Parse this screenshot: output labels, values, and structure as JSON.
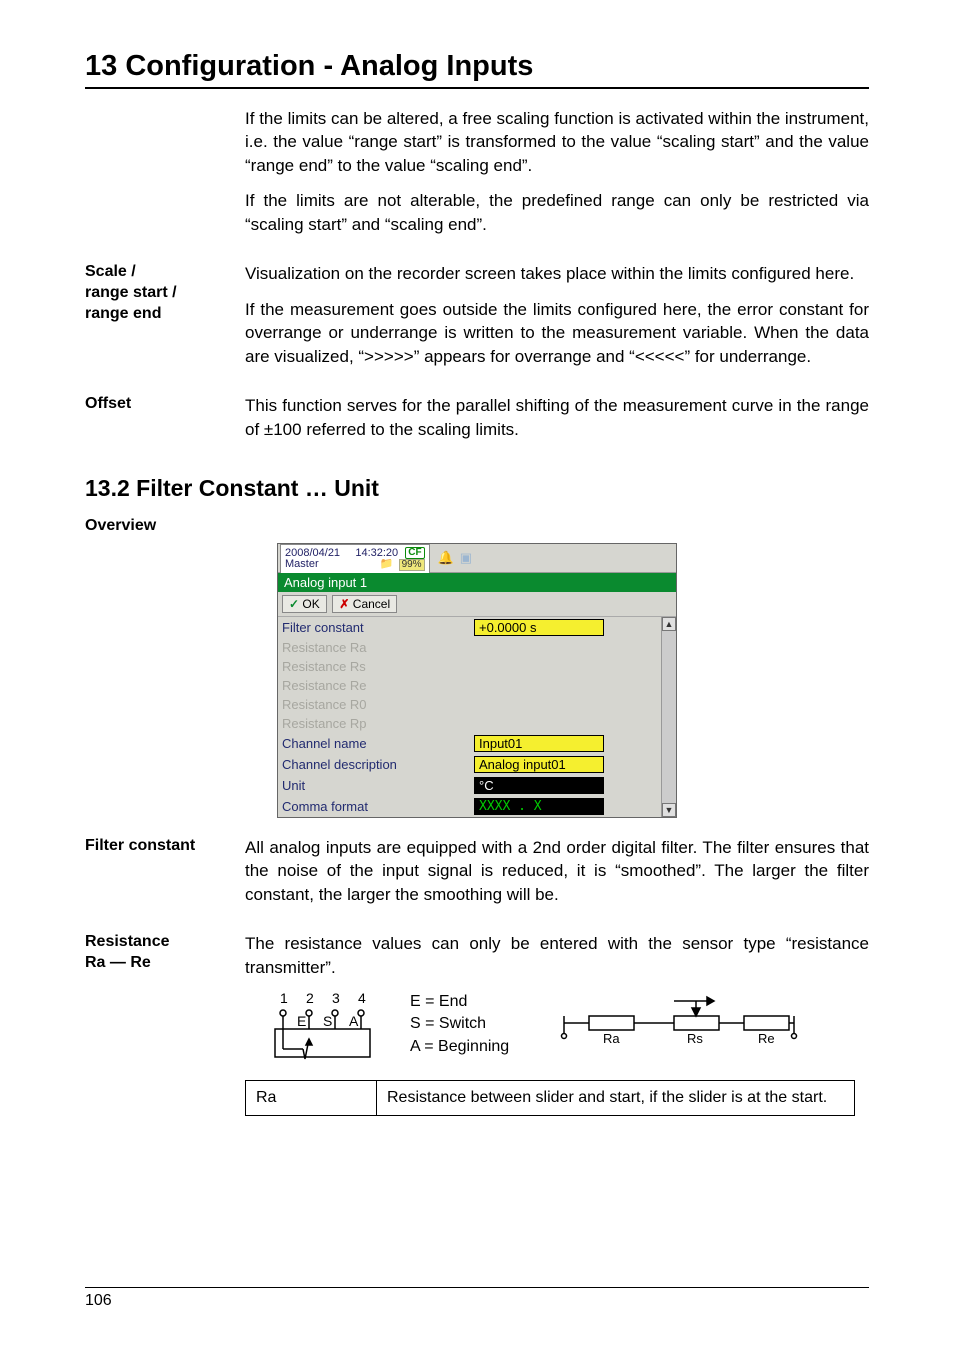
{
  "chapterTitle": "13 Configuration - Analog Inputs",
  "para1": "If the limits can be altered, a free scaling function is activated within the instrument, i.e. the value “range start” is transformed to the value “scaling start” and the value “range end” to the value “scaling end”.",
  "para2": "If the limits are not alterable, the predefined range can only be restricted via “scaling start” and “scaling end”.",
  "scale": {
    "label": "Scale /\nrange start /\nrange end",
    "p1": "Visualization on the recorder screen takes place within the limits configured here.",
    "p2": "If the measurement goes outside the limits configured here, the error constant for overrange or underrange is written to the measurement variable. When the data are visualized, “>>>>>” appears for overrange and “<<<<<” for underrange."
  },
  "offset": {
    "label": "Offset",
    "p": "This function serves for the parallel shifting of the measurement curve in the range of ±100 referred to the scaling limits."
  },
  "sectionTitle": "13.2   Filter Constant … Unit",
  "overviewLabel": "Overview",
  "shot": {
    "date": "2008/04/21",
    "time": "14:32:20",
    "master": "Master",
    "pct": "99%",
    "greenbar": "Analog input 1",
    "ok": "OK",
    "cancel": "Cancel",
    "rows": [
      {
        "label": "Filter constant",
        "dis": false,
        "valtype": "y",
        "val": "+0.0000 s"
      },
      {
        "label": "Resistance Ra",
        "dis": true,
        "valtype": "",
        "val": ""
      },
      {
        "label": "Resistance Rs",
        "dis": true,
        "valtype": "",
        "val": ""
      },
      {
        "label": "Resistance Re",
        "dis": true,
        "valtype": "",
        "val": ""
      },
      {
        "label": "Resistance R0",
        "dis": true,
        "valtype": "",
        "val": ""
      },
      {
        "label": "Resistance Rp",
        "dis": true,
        "valtype": "",
        "val": ""
      },
      {
        "label": "Channel name",
        "dis": false,
        "valtype": "y",
        "val": "Input01"
      },
      {
        "label": "Channel description",
        "dis": false,
        "valtype": "y",
        "val": "Analog input01"
      },
      {
        "label": "Unit",
        "dis": false,
        "valtype": "bw",
        "val": "°C"
      },
      {
        "label": "Comma format",
        "dis": false,
        "valtype": "bk",
        "val": "XXXX . X"
      }
    ]
  },
  "filter": {
    "label": "Filter constant",
    "p": "All analog inputs are equipped with a 2nd order digital filter. The filter ensures that the noise of the input signal is reduced, it is “smoothed”. The larger the filter constant, the larger the smoothing will be."
  },
  "res": {
    "label": "Resistance\nRa — Re",
    "p": "The resistance values can only be entered with the sensor type “resistance transmitter”."
  },
  "circuit": {
    "nums": [
      "1",
      "2",
      "3",
      "4"
    ],
    "letters": [
      "E",
      "S",
      "A"
    ],
    "eLine": "E = End",
    "sLine": "S = Switch",
    "aLine": "A = Beginning",
    "r": {
      "ra": "Ra",
      "rs": "Rs",
      "re": "Re"
    }
  },
  "table": {
    "c1": "Ra",
    "c2": "Resistance between slider and start, if the slider is at the start."
  },
  "pageNum": "106"
}
